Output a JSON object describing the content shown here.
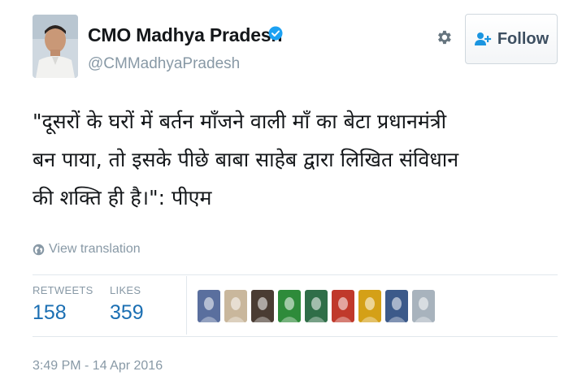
{
  "user": {
    "display_name": "CMO Madhya Pradesh",
    "handle": "@CMMadhyaPradesh",
    "avatar_icon": "profile-photo",
    "verified_icon": "verified-badge-icon",
    "verified_color": "#1da1f2"
  },
  "actions": {
    "settings_icon": "gear-icon",
    "follow_icon": "add-user-icon",
    "follow_label": "Follow"
  },
  "tweet": {
    "lines": [
      "\"दूसरों के घरों में बर्तन माँजने वाली माँ का बेटा प्रधानमंत्री",
      "बन पाया, तो इसके पीछे बाबा साहेब द्वारा लिखित संविधान",
      "की शक्ति ही है।\": पीएम"
    ],
    "translate_icon": "globe-icon",
    "translate_label": "View translation",
    "timestamp": "3:49 PM - 14 Apr 2016"
  },
  "stats": {
    "retweets_label": "RETWEETS",
    "retweets_value": "158",
    "likes_label": "LIKES",
    "likes_value": "359"
  },
  "likers": [
    {
      "icon": "liker-avatar",
      "color": "#5a6f9e"
    },
    {
      "icon": "liker-avatar",
      "color": "#c9b79c"
    },
    {
      "icon": "liker-avatar",
      "color": "#4a3c33"
    },
    {
      "icon": "liker-avatar",
      "color": "#2e8b3a"
    },
    {
      "icon": "liker-avatar",
      "color": "#2f6e48"
    },
    {
      "icon": "liker-avatar",
      "color": "#c0392b"
    },
    {
      "icon": "liker-avatar",
      "color": "#d4a017"
    },
    {
      "icon": "liker-avatar",
      "color": "#3c5a8a"
    },
    {
      "icon": "liker-avatar",
      "color": "#a8b3bd"
    }
  ],
  "colors": {
    "link_blue": "#1b6fb3",
    "muted_gray": "#8899a6",
    "divider": "#e1e8ed"
  }
}
